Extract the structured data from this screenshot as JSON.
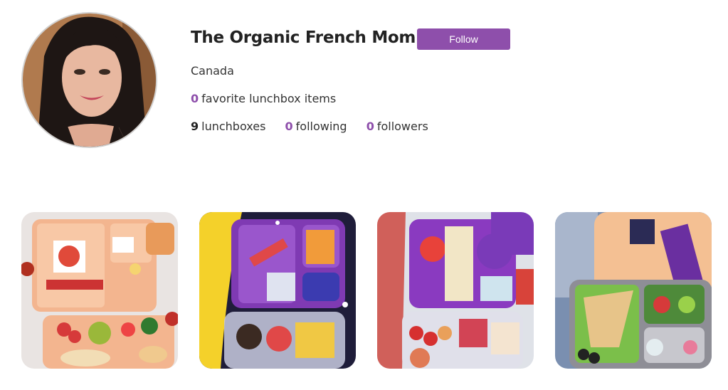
{
  "profile": {
    "name": "The Organic French Mom",
    "location": "Canada",
    "avatar": "profile-photo"
  },
  "follow_button": {
    "label": "Follow",
    "color": "#8e4fab"
  },
  "favorites": {
    "count": "0",
    "label": "favorite lunchbox items"
  },
  "stats": {
    "lunchboxes": {
      "count": "9",
      "label": "lunchboxes"
    },
    "following": {
      "count": "0",
      "label": "following"
    },
    "followers": {
      "count": "0",
      "label": "followers"
    }
  },
  "lunchbox_photos": [
    {
      "name": "lunchbox-photo-1"
    },
    {
      "name": "lunchbox-photo-2"
    },
    {
      "name": "lunchbox-photo-3"
    },
    {
      "name": "lunchbox-photo-4"
    }
  ],
  "accent_color": "#8e4fab"
}
